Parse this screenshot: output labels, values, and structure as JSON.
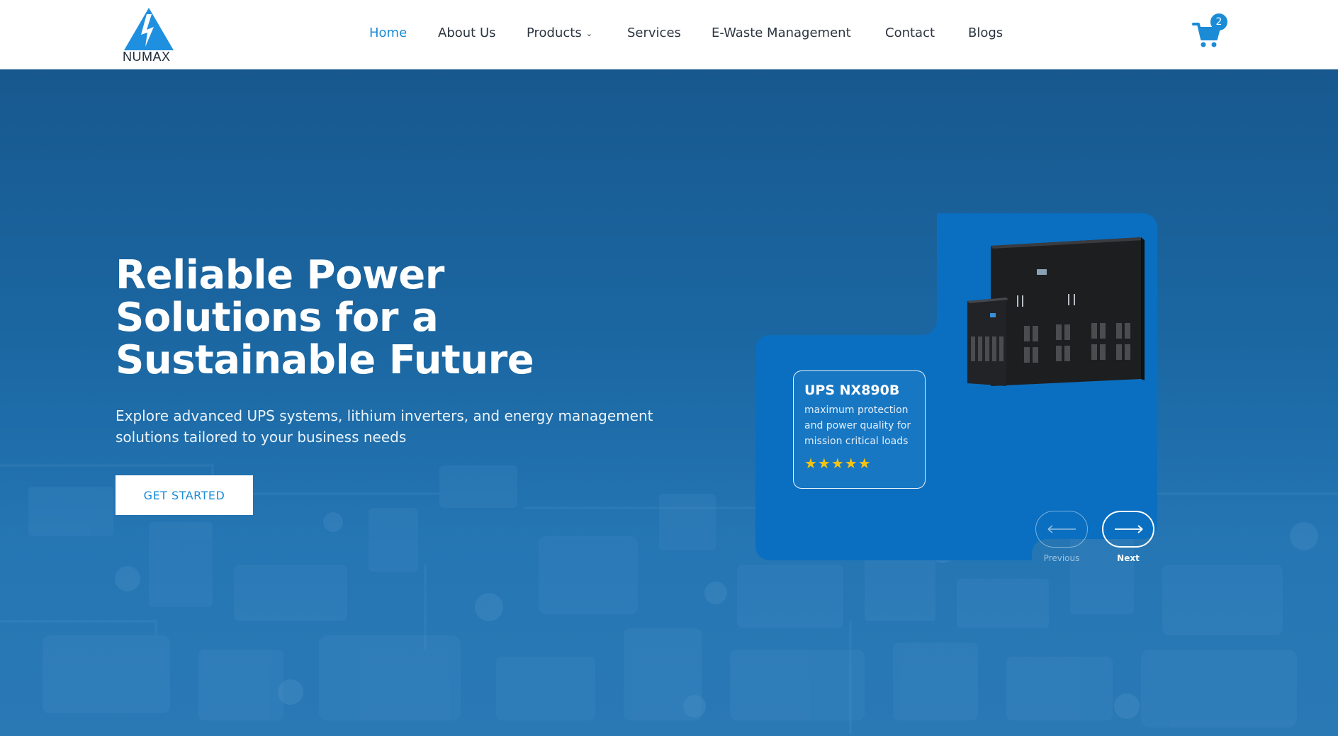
{
  "brand": {
    "name": "NUMAX",
    "accent": "#1b8bd6",
    "logo_icon": "lightning-bolt-icon"
  },
  "nav": {
    "items": [
      {
        "label": "Home",
        "active": true
      },
      {
        "label": "About Us"
      },
      {
        "label": "Products",
        "has_dropdown": true
      },
      {
        "label": "Services"
      },
      {
        "label": "E-Waste Management"
      },
      {
        "label": "Contact"
      },
      {
        "label": "Blogs"
      }
    ],
    "cart": {
      "icon": "cart-icon",
      "count": "2"
    }
  },
  "hero": {
    "title_lines": [
      "Reliable Power",
      "Solutions for a",
      "Sustainable Future"
    ],
    "subtitle": "Explore advanced UPS systems, lithium inverters, and energy management solutions tailored to your business needs",
    "cta_label": "GET STARTED",
    "background_color": "#1c6aa6"
  },
  "product": {
    "name": "UPS NX890B",
    "description": "maximum protection and power quality for mission critical loads",
    "rating": "★★★★★",
    "card_color": "#0a6fc0",
    "star_color": "#f6c313"
  },
  "slider": {
    "prev_label": "Previous",
    "next_label": "Next"
  }
}
